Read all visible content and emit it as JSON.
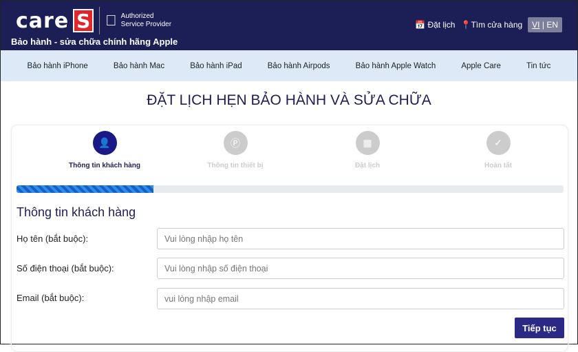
{
  "header": {
    "logo_text": "care",
    "logo_s": "S",
    "authorized": "Authorized",
    "service_provider": "Service Provider",
    "tagline": "Bảo hành - sửa chữa chính hãng Apple",
    "book": "Đặt lịch",
    "find_store": "Tìm cửa hàng",
    "lang_vi": "VI",
    "lang_sep": "|",
    "lang_en": "EN"
  },
  "nav": [
    "Bảo hành iPhone",
    "Bảo hành Mac",
    "Bảo hành iPad",
    "Bảo hành Airpods",
    "Bảo hành Apple Watch",
    "Apple Care",
    "Tin tức"
  ],
  "page_title": "ĐẶT LỊCH HẸN BẢO HÀNH VÀ SỬA CHỮA",
  "steps": [
    {
      "label": "Thông tin khách hàng",
      "icon": "user-icon",
      "active": true
    },
    {
      "label": "Thông tin thiết bị",
      "icon": "device-icon",
      "active": false
    },
    {
      "label": "Đặt lịch",
      "icon": "calendar-icon",
      "active": false
    },
    {
      "label": "Hoàn tất",
      "icon": "check-icon",
      "active": false
    }
  ],
  "progress_percent": 25,
  "form": {
    "section_title": "Thông tin khách hàng",
    "name_label": "Họ tên (bắt buộc):",
    "name_placeholder": "Vui lòng nhập họ tên",
    "name_value": "",
    "phone_label": "Số điện thoại (bắt buộc):",
    "phone_placeholder": "Vui lòng nhập số điện thoại",
    "phone_value": "",
    "email_label": "Email (bắt buộc):",
    "email_placeholder": "vui lòng nhập email",
    "email_value": "",
    "continue": "Tiếp tục"
  },
  "colors": {
    "header": "#1c1f55",
    "accent": "#191a86",
    "logo_red": "#e0252b",
    "nav_bg": "#dde9f7"
  }
}
